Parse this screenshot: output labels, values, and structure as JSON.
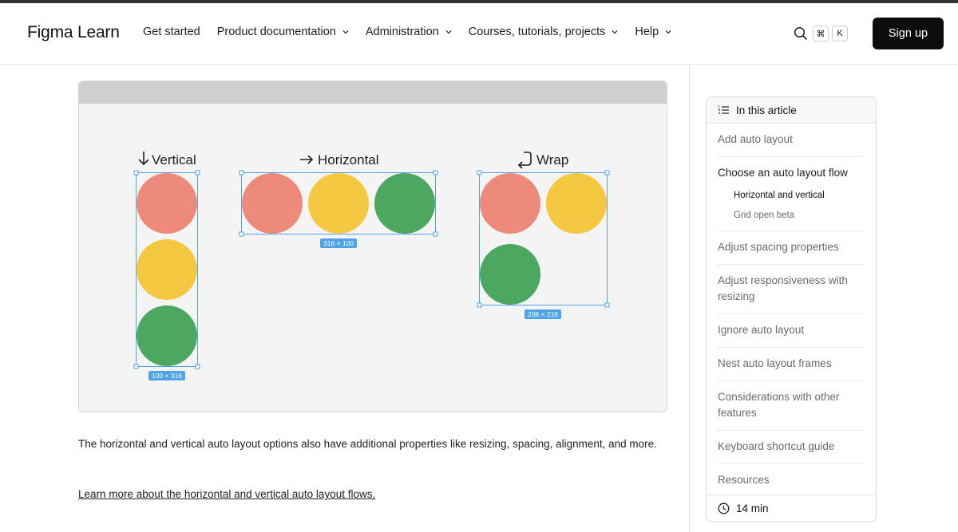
{
  "header": {
    "logo": "Figma Learn",
    "nav": [
      {
        "label": "Get started",
        "has_dropdown": false
      },
      {
        "label": "Product documentation",
        "has_dropdown": true
      },
      {
        "label": "Administration",
        "has_dropdown": true
      },
      {
        "label": "Courses, tutorials, projects",
        "has_dropdown": true
      },
      {
        "label": "Help",
        "has_dropdown": true
      }
    ],
    "search_icon": "search-icon",
    "shortcut_keys": [
      "⌘",
      "K"
    ],
    "signup_label": "Sign up"
  },
  "figure": {
    "groups": [
      {
        "icon": "arrow-down-icon",
        "label": "Vertical",
        "dimensions": "100 × 316"
      },
      {
        "icon": "arrow-right-icon",
        "label": "Horizontal",
        "dimensions": "316 × 100"
      },
      {
        "icon": "wrap-arrow-icon",
        "label": "Wrap",
        "dimensions": "208 × 216"
      }
    ],
    "colors": {
      "red": "#EE8A7B",
      "yellow": "#F5C842",
      "green": "#4CA860",
      "selection": "#4FA3E8"
    }
  },
  "content": {
    "paragraph": "The horizontal and vertical auto layout options also have additional properties like resizing, spacing, alignment, and more.",
    "link": "Learn more about the horizontal and vertical auto layout flows."
  },
  "toc": {
    "title": "In this article",
    "items": [
      {
        "label": "Add auto layout"
      },
      {
        "label": "Choose an auto layout flow",
        "active": true,
        "children": [
          {
            "label": "Horizontal and vertical",
            "active": true
          },
          {
            "label": "Grid open beta"
          }
        ]
      },
      {
        "label": "Adjust spacing properties"
      },
      {
        "label": "Adjust responsiveness with resizing"
      },
      {
        "label": "Ignore auto layout"
      },
      {
        "label": "Nest auto layout frames"
      },
      {
        "label": "Considerations with other features"
      },
      {
        "label": "Keyboard shortcut guide"
      },
      {
        "label": "Resources"
      }
    ],
    "read_time": "14 min"
  }
}
